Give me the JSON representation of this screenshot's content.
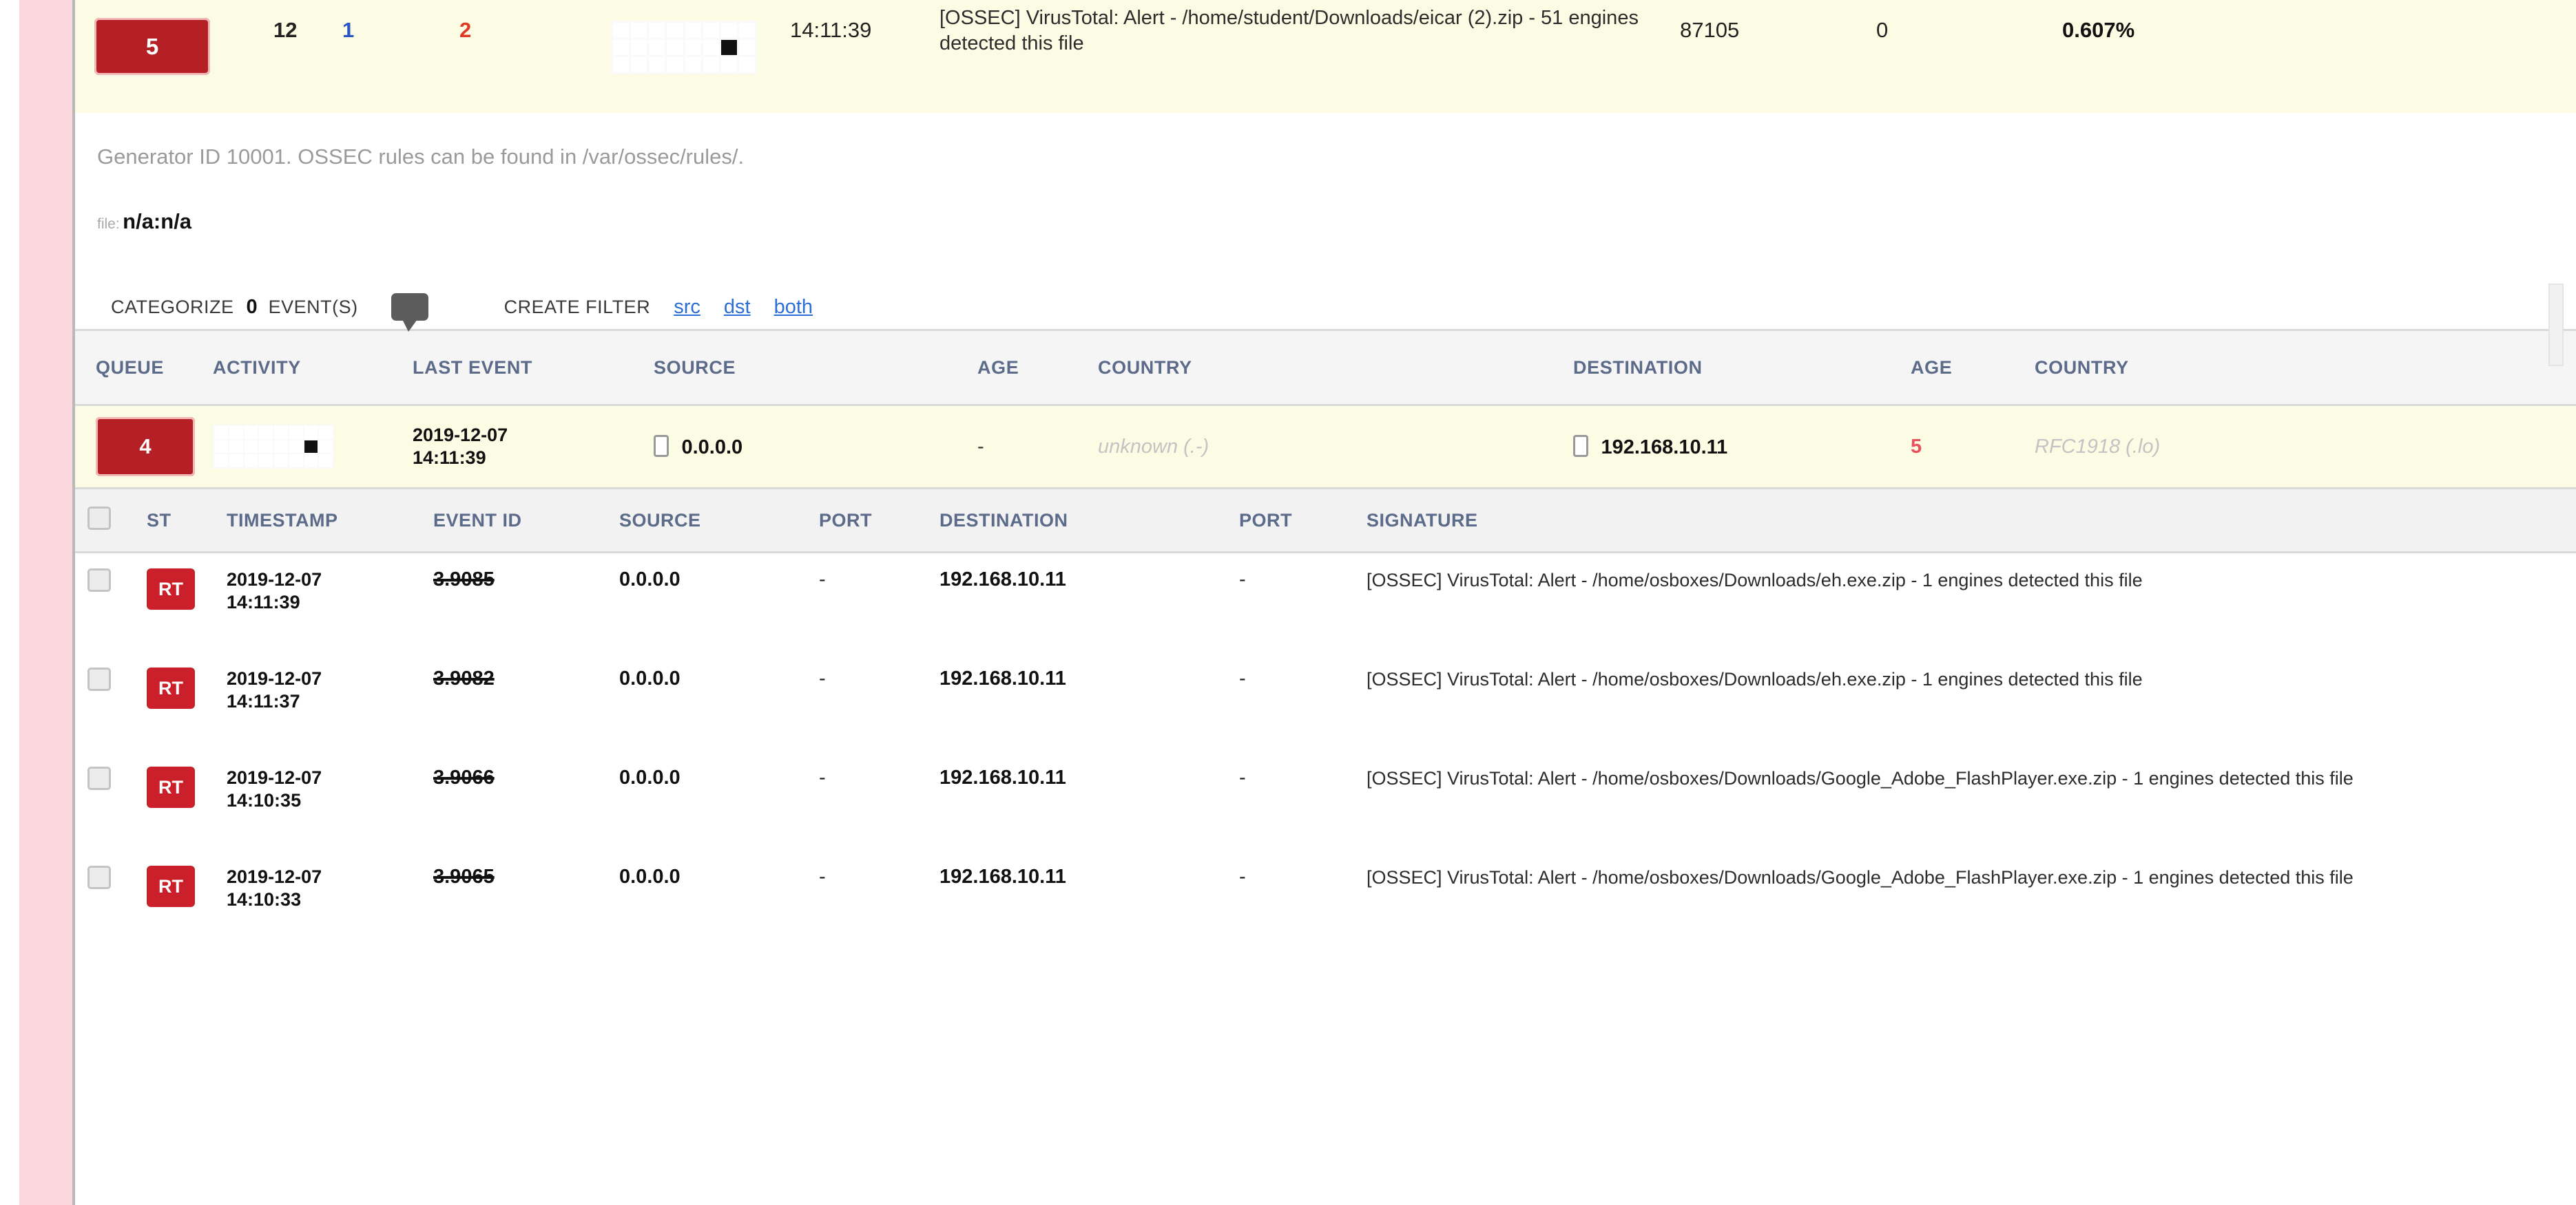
{
  "alert_summary": {
    "queue_count": "5",
    "total_count": "12",
    "source_count": "1",
    "dest_count": "2",
    "activity_icon": "activity-sparkline-grid",
    "last_event_time": "14:11:39",
    "signature": "[OSSEC] VirusTotal: Alert - /home/student/Downloads/eicar (2).zip - 51 engines detected this file",
    "event_id": "87105",
    "zero_value": "0",
    "percentage": "0.607%"
  },
  "detail": {
    "generator_text": "Generator ID 10001. OSSEC rules can be found in /var/ossec/rules/.",
    "file_label": "file:",
    "file_value": "n/a:n/a"
  },
  "actions": {
    "categorize_label": "CATEGORIZE",
    "event_count": "0",
    "events_label": "EVENT(S)",
    "comment_icon": "speech-bubble-icon",
    "create_filter_label": "CREATE FILTER",
    "filter_links": [
      "src",
      "dst",
      "both"
    ]
  },
  "session_table": {
    "headers": [
      "QUEUE",
      "ACTIVITY",
      "LAST EVENT",
      "SOURCE",
      "AGE",
      "COUNTRY",
      "DESTINATION",
      "AGE",
      "COUNTRY"
    ],
    "row": {
      "queue": "4",
      "activity_icon": "activity-sparkline-grid",
      "last_event": "2019-12-07 14:11:39",
      "last_event_date": "2019-12-07",
      "last_event_time": "14:11:39",
      "source_icon": "ip-host-icon",
      "source": "0.0.0.0",
      "source_age": "-",
      "source_country": "unknown (.-)",
      "dest_icon": "ip-host-icon",
      "destination": "192.168.10.11",
      "dest_age": "5",
      "dest_country": "RFC1918 (.lo)"
    }
  },
  "event_table": {
    "headers": [
      "",
      "ST",
      "TIMESTAMP",
      "EVENT ID",
      "SOURCE",
      "PORT",
      "DESTINATION",
      "PORT",
      "SIGNATURE"
    ],
    "rows": [
      {
        "checkbox": "unchecked",
        "status": "RT",
        "date": "2019-12-07",
        "time": "14:11:39",
        "event_id": "3.9085",
        "source": "0.0.0.0",
        "src_port": "-",
        "destination": "192.168.10.11",
        "dst_port": "-",
        "signature": "[OSSEC] VirusTotal: Alert - /home/osboxes/Downloads/eh.exe.zip - 1 engines detected this file"
      },
      {
        "checkbox": "unchecked",
        "status": "RT",
        "date": "2019-12-07",
        "time": "14:11:37",
        "event_id": "3.9082",
        "source": "0.0.0.0",
        "src_port": "-",
        "destination": "192.168.10.11",
        "dst_port": "-",
        "signature": "[OSSEC] VirusTotal: Alert - /home/osboxes/Downloads/eh.exe.zip - 1 engines detected this file"
      },
      {
        "checkbox": "unchecked",
        "status": "RT",
        "date": "2019-12-07",
        "time": "14:10:35",
        "event_id": "3.9066",
        "source": "0.0.0.0",
        "src_port": "-",
        "destination": "192.168.10.11",
        "dst_port": "-",
        "signature": "[OSSEC] VirusTotal: Alert - /home/osboxes/Downloads/Google_Adobe_FlashPlayer.exe.zip - 1 engines detected this file"
      },
      {
        "checkbox": "unchecked",
        "status": "RT",
        "date": "2019-12-07",
        "time": "14:10:33",
        "event_id": "3.9065",
        "source": "0.0.0.0",
        "src_port": "-",
        "destination": "192.168.10.11",
        "dst_port": "-",
        "signature": "[OSSEC] VirusTotal: Alert - /home/osboxes/Downloads/Google_Adobe_FlashPlayer.exe.zip - 1 engines detected this file"
      }
    ]
  },
  "colors": {
    "queue_red": "#b51f26",
    "status_red": "#c9202a",
    "highlight_yellow": "#fcfce4",
    "gutter_pink": "#fdd7de",
    "link_blue": "#2b6fd6",
    "header_blue": "#5d6b8a",
    "source_blue": "#2b55c4",
    "dest_red": "#e03a27"
  }
}
